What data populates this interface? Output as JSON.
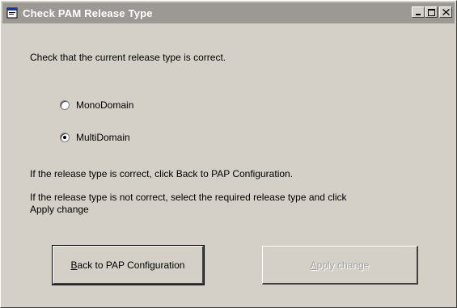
{
  "window": {
    "title": "Check PAM Release Type",
    "controls": {
      "minimize": "_",
      "maximize": "□",
      "close": "×"
    }
  },
  "dialog": {
    "intro": "Check that the current release type is correct.",
    "options": [
      {
        "label": "MonoDomain",
        "checked": false
      },
      {
        "label": "MultiDomain",
        "checked": true
      }
    ],
    "hint_correct": "If the release type is correct, click Back to PAP Configuration.",
    "hint_incorrect_line1": "If the release type is not correct, select the required release type and click",
    "hint_incorrect_line2": "Apply change"
  },
  "buttons": {
    "back": {
      "mnemonic": "B",
      "rest": "ack to PAP Configuration",
      "enabled": true
    },
    "apply": {
      "mnemonic": "A",
      "rest": "pply change",
      "enabled": false
    }
  }
}
